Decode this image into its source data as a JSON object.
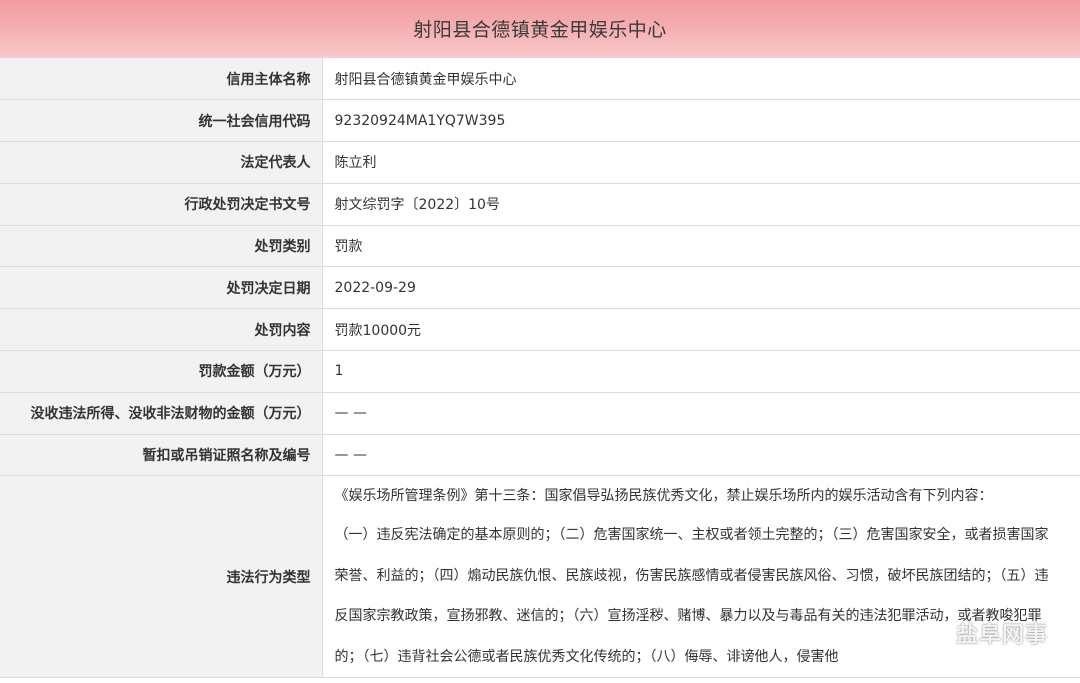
{
  "header": {
    "title": "射阳县合德镇黄金甲娱乐中心"
  },
  "rows": [
    {
      "label": "信用主体名称",
      "value": "射阳县合德镇黄金甲娱乐中心"
    },
    {
      "label": "统一社会信用代码",
      "value": "92320924MA1YQ7W395"
    },
    {
      "label": "法定代表人",
      "value": "陈立利"
    },
    {
      "label": "行政处罚决定书文号",
      "value": "射文综罚字〔2022〕10号"
    },
    {
      "label": "处罚类别",
      "value": "罚款"
    },
    {
      "label": "处罚决定日期",
      "value": "2022-09-29"
    },
    {
      "label": "处罚内容",
      "value": "罚款10000元"
    },
    {
      "label": "罚款金额（万元）",
      "value": "1"
    },
    {
      "label": "没收违法所得、没收非法财物的金额（万元）",
      "value": "— —"
    },
    {
      "label": "暂扣或吊销证照名称及编号",
      "value": "— —"
    }
  ],
  "violation": {
    "label": "违法行为类型",
    "paragraph1": "《娱乐场所管理条例》第十三条：国家倡导弘扬民族优秀文化，禁止娱乐场所内的娱乐活动含有下列内容：",
    "paragraph2": "（一）违反宪法确定的基本原则的；（二）危害国家统一、主权或者领土完整的；（三）危害国家安全，或者损害国家荣誉、利益的；（四）煽动民族仇恨、民族歧视，伤害民族感情或者侵害民族风俗、习惯，破坏民族团结的；（五）违反国家宗教政策，宣扬邪教、迷信的；（六）宣扬淫秽、赌博、暴力以及与毒品有关的违法犯罪活动，或者教唆犯罪的；（七）违背社会公德或者民族优秀文化传统的；（八）侮辱、诽谤他人，侵害他"
  },
  "watermark": {
    "text": "盐阜网事",
    "icon": "wechat-icon"
  }
}
